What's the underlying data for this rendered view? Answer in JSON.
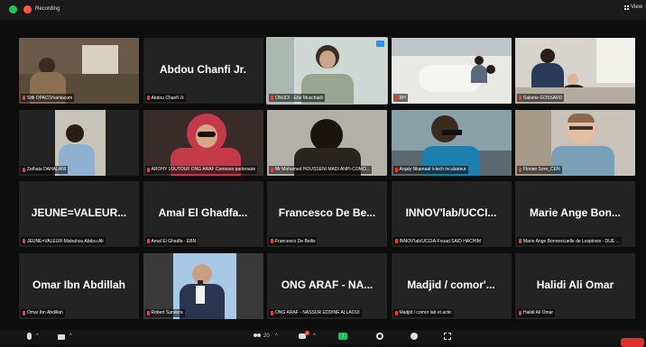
{
  "header": {
    "recording_label": "Recording",
    "view_label": "View"
  },
  "tiles": [
    {
      "name": "Sitti OPACO/vaniacom",
      "display": "",
      "row": 0,
      "col": 0,
      "video": true,
      "scene": "room"
    },
    {
      "name": "Abdou Chanfi Jr.",
      "display": "Abdou Chanfi Jr.",
      "row": 0,
      "col": 1,
      "video": false
    },
    {
      "name": "ONUDI - Ebe Muschialli",
      "display": "",
      "row": 0,
      "col": 2,
      "video": true,
      "scene": "woman",
      "speaking": true
    },
    {
      "name": "RH",
      "display": "",
      "row": 0,
      "col": 3,
      "video": true,
      "scene": "office"
    },
    {
      "name": "Salome GOSSARD",
      "display": "",
      "row": 0,
      "col": 4,
      "video": true,
      "scene": "office2"
    },
    {
      "name": "Zalhata DAHALANI",
      "display": "",
      "row": 1,
      "col": 0,
      "video": true,
      "scene": "box"
    },
    {
      "name": "AROHY LOUTOUF ONG ARAF Comores partenaire",
      "display": "",
      "row": 1,
      "col": 1,
      "video": true,
      "scene": "hijab"
    },
    {
      "name": "Mr Mohamed HOUSSENI MADI ANPI-COMO...",
      "display": "",
      "row": 1,
      "col": 2,
      "video": true,
      "scene": "dark"
    },
    {
      "name": "Anjaly Nkamaal ii-tech incubateur",
      "display": "",
      "row": 1,
      "col": 3,
      "video": true,
      "scene": "man-headset"
    },
    {
      "name": "Florian Sore_CEN",
      "display": "",
      "row": 1,
      "col": 4,
      "video": true,
      "scene": "man-glasses"
    },
    {
      "name": "JEUNE=VALEUR-Misbahou Abdou Ali",
      "display": "JEUNE=VALEUR...",
      "row": 2,
      "col": 0,
      "video": false
    },
    {
      "name": "Amal El Ghadfa - EBN",
      "display": "Amal El Ghadfa...",
      "row": 2,
      "col": 1,
      "video": false
    },
    {
      "name": "Francesco De Bellis",
      "display": "Francesco De Be...",
      "row": 2,
      "col": 2,
      "video": false
    },
    {
      "name": "INNOV'lab/UCCIA-Fouad SAID HACHIM",
      "display": "INNOV'lab/UCCI...",
      "row": 2,
      "col": 3,
      "video": false
    },
    {
      "name": "Marie Ange Bonnescuelle de Lespinois - DUE ...",
      "display": "Marie Ange Bon...",
      "row": 2,
      "col": 4,
      "video": false
    },
    {
      "name": "Omar Ibn Abdillah",
      "display": "Omar Ibn Abdillah",
      "row": 3,
      "col": 0,
      "video": false
    },
    {
      "name": "Robert Sanders",
      "display": "",
      "row": 3,
      "col": 1,
      "video": true,
      "scene": "speaker"
    },
    {
      "name": "ONG ARAF - NASSUR EDDINE ALLAOUI",
      "display": "ONG ARAF - NA...",
      "row": 3,
      "col": 2,
      "video": false
    },
    {
      "name": "Madjid / comor lab et actic",
      "display": "Madjid / comor'...",
      "row": 3,
      "col": 3,
      "video": false
    },
    {
      "name": "Halidi Ali Omar",
      "display": "Halidi Ali Omar",
      "row": 3,
      "col": 4,
      "video": false
    }
  ],
  "toolbar": {
    "participants_count": "20",
    "chat_badge": "1",
    "share_symbol": "↑"
  },
  "colors": {
    "accent_speaking": "#b8d84a",
    "recording": "#ff5a3c",
    "share": "#1ec15c",
    "muted_mic": "#ff3b30",
    "end": "#d9322f"
  }
}
